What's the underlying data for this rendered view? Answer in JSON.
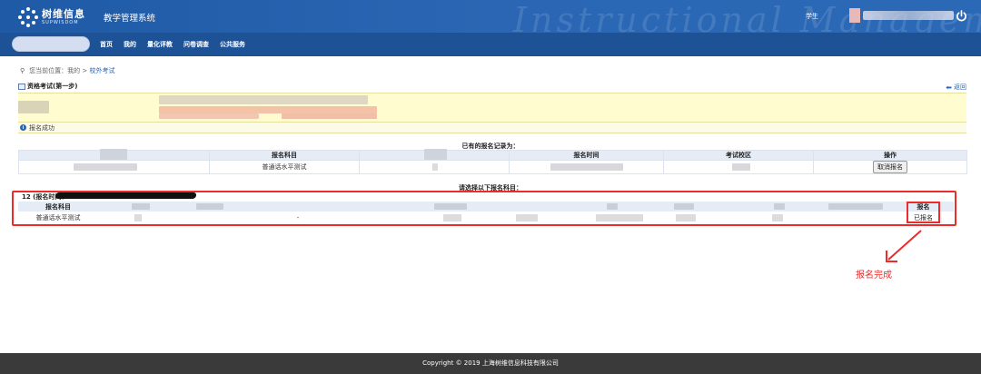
{
  "header": {
    "logo_cn": "树维信息",
    "logo_en": "SUPWISDOM",
    "system_title": "教学管理系统",
    "watermark": "Instructional Management",
    "user_role": "学生"
  },
  "nav": {
    "items": [
      "首页",
      "我的",
      "量化评教",
      "问卷调查",
      "公共服务"
    ]
  },
  "breadcrumb": {
    "prefix": "您当前位置：我的 >",
    "current": "校外考试"
  },
  "panel": {
    "title": "资格考试(第一步)",
    "back_label": "返回"
  },
  "success_message": "报名成功",
  "records": {
    "title": "已有的报名记录为：",
    "headers": [
      "",
      "报名科目",
      "",
      "报名时间",
      "考试校区",
      "操作"
    ],
    "row": {
      "subject": "普通话水平测试",
      "action": "取消报名"
    }
  },
  "selection": {
    "title": "请选择以下报名科目：",
    "round_label": "12 (报名时间：",
    "headers": [
      "报名科目"
    ],
    "row": {
      "subject": "普通话水平测试",
      "dash": "-"
    },
    "status_header": "报名",
    "status_value": "已报名"
  },
  "annotation": {
    "text": "报名完成",
    "color": "#ec2b2b"
  },
  "footer": {
    "copyright": "Copyright © 2019 上海树维信息科技有限公司"
  },
  "colors": {
    "header_blue": "#1f5aa6",
    "nav_blue": "#1e5297",
    "highlight_yellow": "#fffdd0",
    "table_head": "#e5ecf6",
    "annotation_red": "#ec2b2b"
  }
}
